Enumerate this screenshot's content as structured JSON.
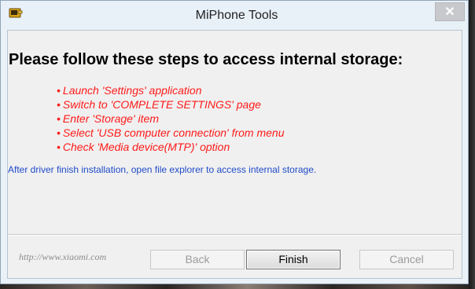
{
  "window": {
    "title": "MiPhone Tools",
    "app_icon": "device-icon",
    "close_icon": "close-icon",
    "close_glyph": "✕"
  },
  "content": {
    "heading": "Please follow these steps to access internal storage:",
    "bullet": "•",
    "steps": [
      "Launch 'Settings' application",
      "Switch to 'COMPLETE SETTINGS' page",
      "Enter 'Storage' item",
      "Select 'USB computer connection' from menu",
      "Check 'Media device(MTP)' option"
    ],
    "info": "After driver finish installation, open file explorer to access internal storage.",
    "step_color": "#ff1a1a",
    "info_color": "#1f4bc8"
  },
  "footer": {
    "link": "http://www.xiaomi.com",
    "back_label": "Back",
    "finish_label": "Finish",
    "cancel_label": "Cancel"
  }
}
